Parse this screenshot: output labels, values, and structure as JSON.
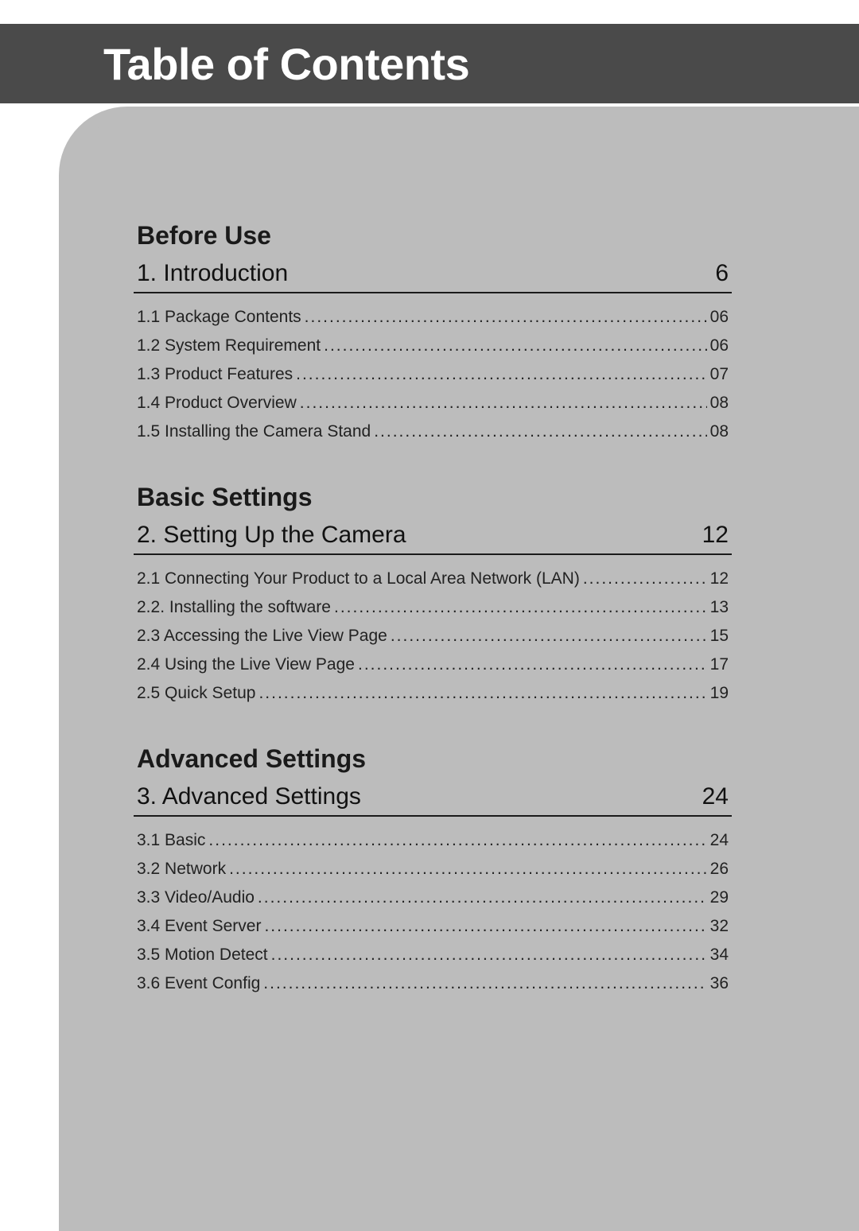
{
  "title": "Table of Contents",
  "sections": [
    {
      "header": "Before Use",
      "chapter": {
        "num": "1.",
        "title": "Introduction",
        "page": "6"
      },
      "subs": [
        {
          "num": "1.1",
          "title": "Package Contents",
          "page": "06"
        },
        {
          "num": "1.2",
          "title": "System Requirement",
          "page": "06"
        },
        {
          "num": "1.3",
          "title": "Product Features",
          "page": "07"
        },
        {
          "num": "1.4",
          "title": "Product Overview",
          "page": "08"
        },
        {
          "num": "1.5",
          "title": "Installing the Camera Stand",
          "page": "08"
        }
      ]
    },
    {
      "header": "Basic Settings",
      "chapter": {
        "num": "2.",
        "title": "Setting Up the Camera",
        "page": "12"
      },
      "subs": [
        {
          "num": "2.1",
          "title": "Connecting Your Product to a Local Area Network (LAN)",
          "page": "12"
        },
        {
          "num": "2.2.",
          "title": "Installing the software",
          "page": "13"
        },
        {
          "num": "2.3",
          "title": "Accessing the Live View Page",
          "page": "15"
        },
        {
          "num": "2.4",
          "title": "Using the Live View Page",
          "page": "17"
        },
        {
          "num": "2.5",
          "title": "Quick Setup",
          "page": "19"
        }
      ]
    },
    {
      "header": "Advanced Settings",
      "chapter": {
        "num": "3.",
        "title": "Advanced Settings",
        "page": "24"
      },
      "subs": [
        {
          "num": "3.1",
          "title": "Basic",
          "page": "24"
        },
        {
          "num": "3.2",
          "title": "Network",
          "page": "26"
        },
        {
          "num": "3.3",
          "title": "Video/Audio",
          "page": "29"
        },
        {
          "num": "3.4",
          "title": "Event Server",
          "page": "32"
        },
        {
          "num": "3.5",
          "title": "Motion Detect",
          "page": "34"
        },
        {
          "num": "3.6",
          "title": "Event Config",
          "page": "36"
        }
      ]
    }
  ]
}
